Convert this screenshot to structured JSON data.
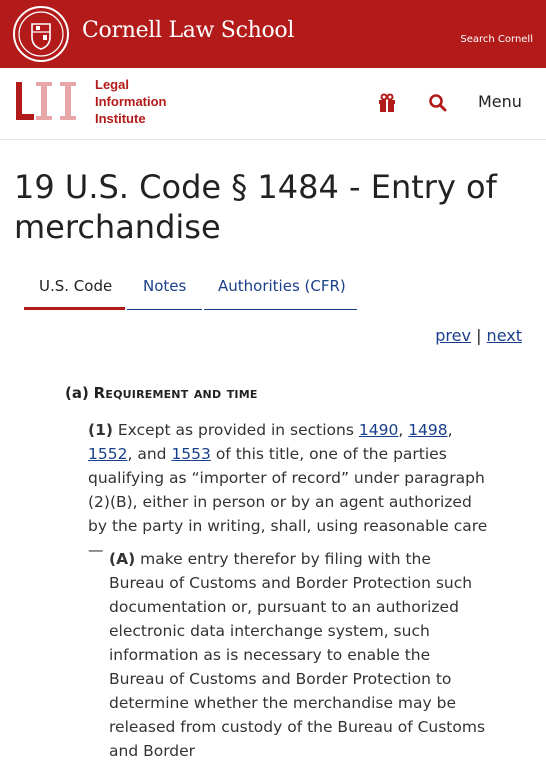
{
  "cornell": {
    "name": "Cornell Law School",
    "search": "Search Cornell"
  },
  "lii": {
    "logo_text": "LII",
    "line1": "Legal",
    "line2": "Information",
    "line3": "Institute",
    "menu": "Menu"
  },
  "page": {
    "title": "19 U.S. Code § 1484 - Entry of merchandise"
  },
  "tabs": [
    {
      "label": "U.S. Code"
    },
    {
      "label": "Notes"
    },
    {
      "label": "Authorities (CFR)"
    }
  ],
  "pager": {
    "prev": "prev",
    "sep": "|",
    "next": "next"
  },
  "section_a": {
    "label": "(a)",
    "title": "Requirement and time"
  },
  "para1": {
    "label": "(1)",
    "t1": "Except as provided in sections",
    "l1": "1490",
    "c1": ",",
    "l2": "1498",
    "c2": ",",
    "l3": "1552",
    "c3": ",",
    "t2": "and",
    "l4": "1553",
    "t3": "of this title, one of the parties qualifying as “importer of record” under paragraph (2)(B), either in person or by an agent authorized by the party in writing, shall, using reasonable care—"
  },
  "paraA": {
    "label": "(A)",
    "text": "make entry therefor by filing with the Bureau of Customs and Border Protection such documentation or, pursuant to an authorized electronic data interchange system, such information as is necessary to enable the Bureau of Customs and Border Protection to determine whether the merchandise may be released from custody of the Bureau of Customs and Border"
  },
  "colors": {
    "cornell_red": "#b31b1b",
    "link_blue": "#1a3f8a"
  }
}
